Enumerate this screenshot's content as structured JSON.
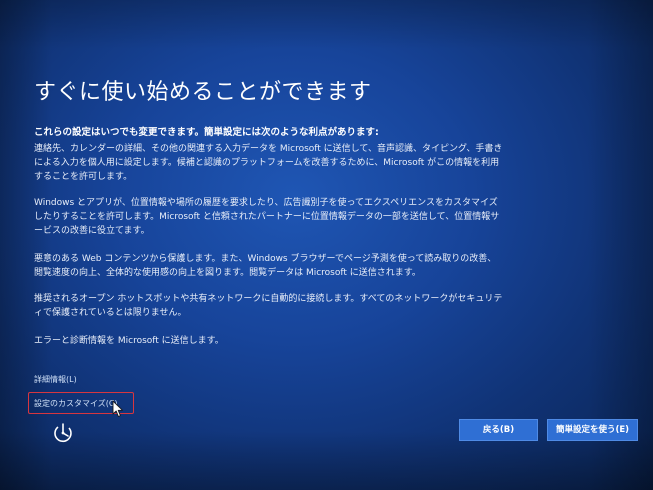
{
  "screen": {
    "title": "すぐに使い始めることができます",
    "lead": "これらの設定はいつでも変更できます。簡単設定には次のような利点があります:",
    "paragraphs": [
      "連絡先、カレンダーの詳細、その他の関連する入力データを Microsoft に送信して、音声認識、タイピング、手書きによる入力を個人用に設定します。候補と認識のプラットフォームを改善するために、Microsoft がこの情報を利用することを許可します。",
      "Windows とアプリが、位置情報や場所の履歴を要求したり、広告識別子を使ってエクスペリエンスをカスタマイズしたりすることを許可します。Microsoft と信頼されたパートナーに位置情報データの一部を送信して、位置情報サービスの改善に役立てます。",
      "悪意のある Web コンテンツから保護します。また、Windows ブラウザーでページ予測を使って読み取りの改善、閲覧速度の向上、全体的な使用感の向上を図ります。閲覧データは Microsoft に送信されます。",
      "推奨されるオープン ホットスポットや共有ネットワークに自動的に接続します。すべてのネットワークがセキュリティで保護されているとは限りません。",
      "エラーと診断情報を Microsoft に送信します。"
    ]
  },
  "links": {
    "details": "詳細情報(L)",
    "customize": "設定のカスタマイズ(C)"
  },
  "buttons": {
    "back": "戻る(B)",
    "express": "簡単設定を使う(E)"
  },
  "icons": {
    "accessibility": "ease-of-access-icon",
    "cursor": "mouse-pointer-icon"
  },
  "colors": {
    "background": "#17449a",
    "button": "#2f6fd4",
    "highlight": "#d7363f"
  }
}
